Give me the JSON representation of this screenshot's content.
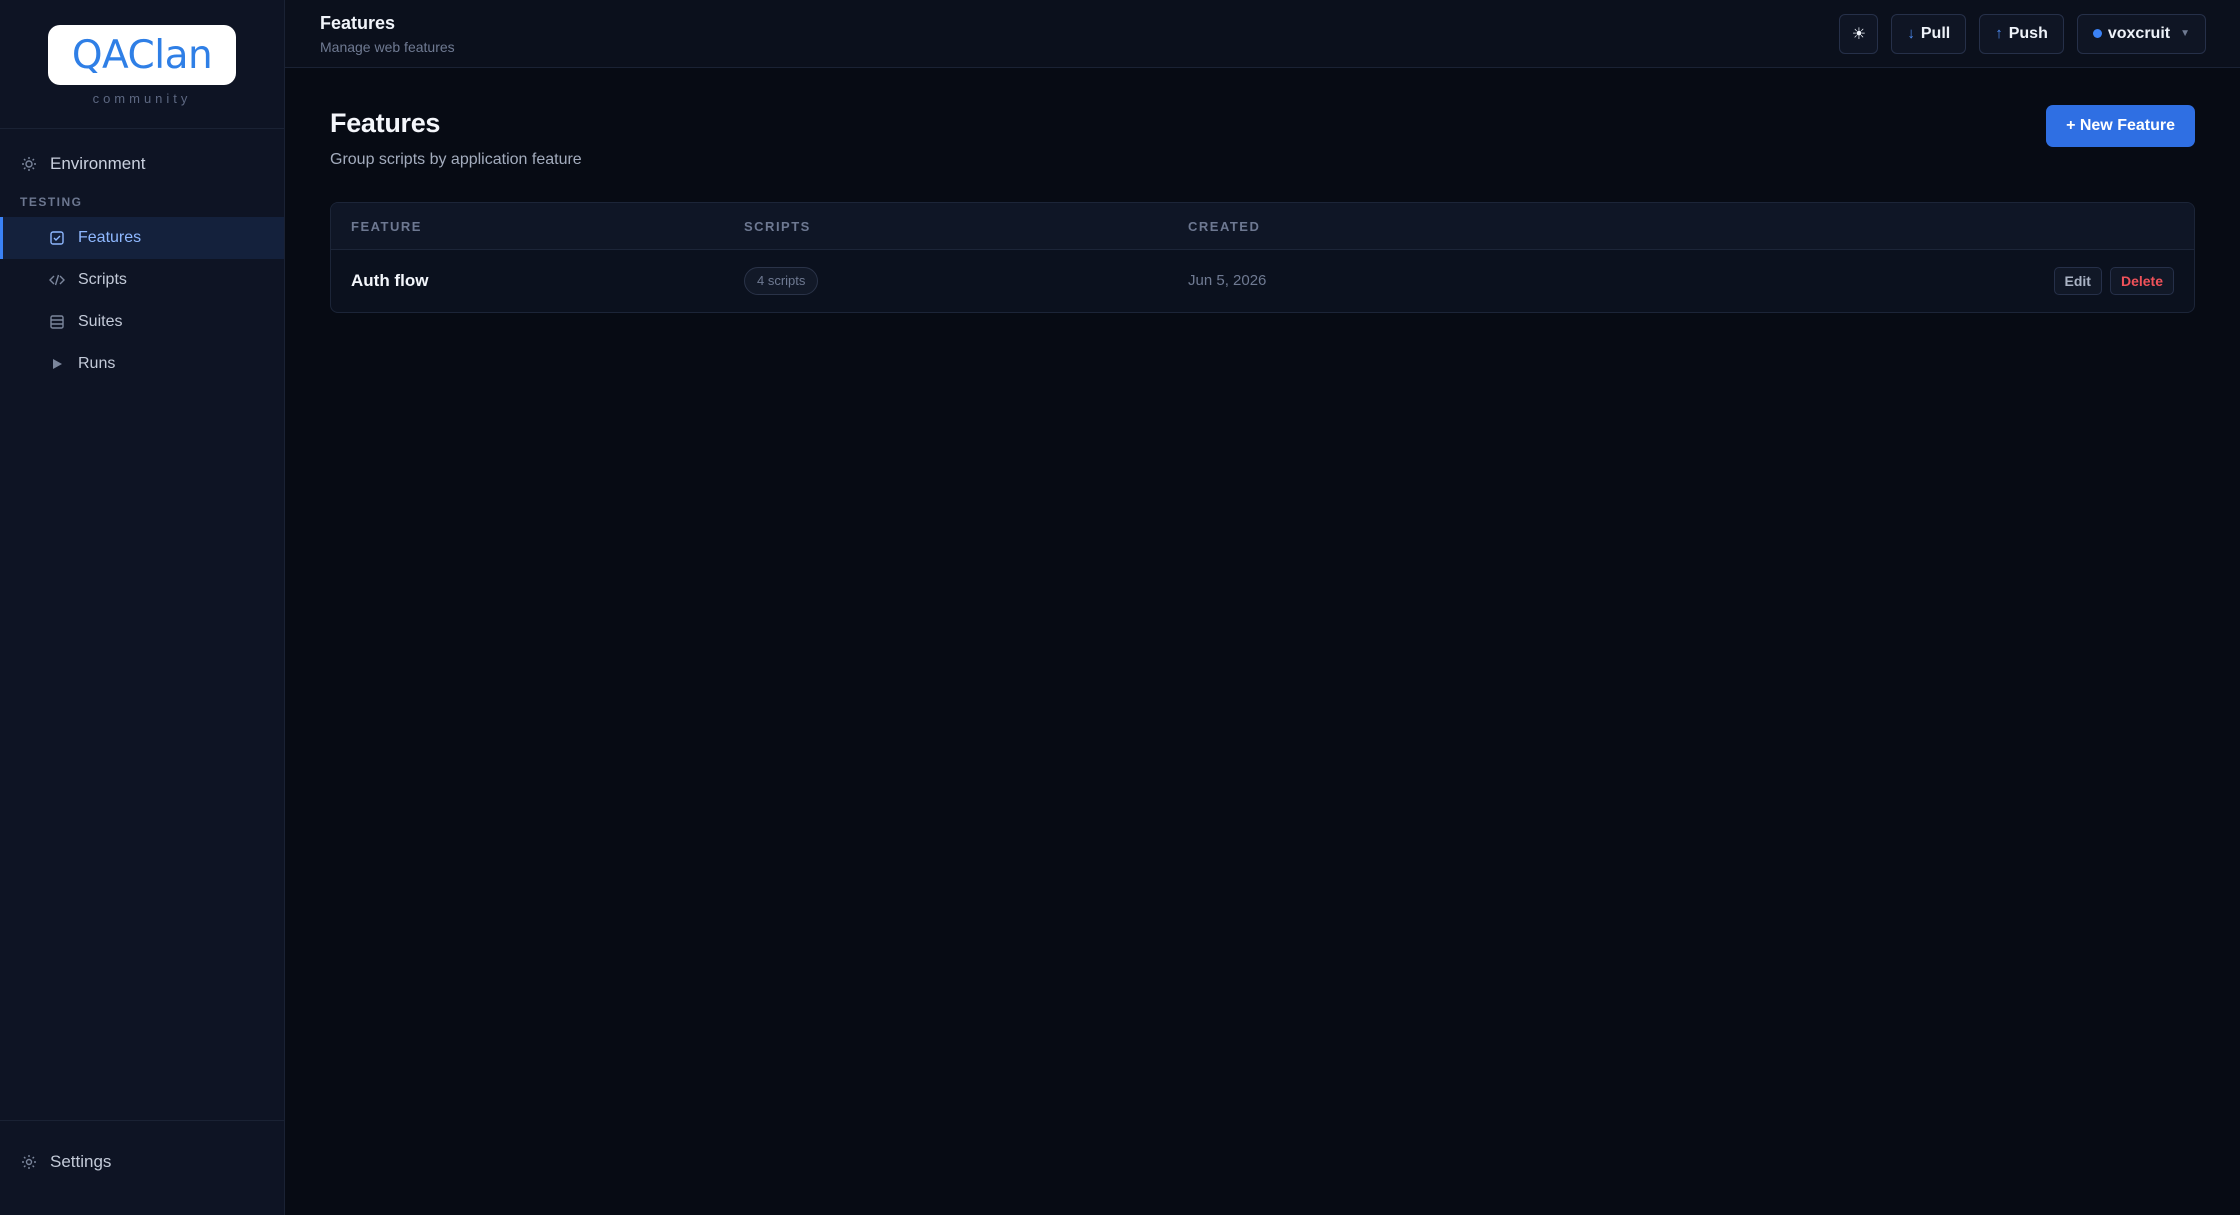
{
  "brand": {
    "logo_text": "QAClan",
    "tagline": "community"
  },
  "sidebar": {
    "environment_label": "Environment",
    "section_label": "TESTING",
    "items": [
      {
        "label": "Features",
        "icon": "checklist-icon",
        "active": true
      },
      {
        "label": "Scripts",
        "icon": "code-icon",
        "active": false
      },
      {
        "label": "Suites",
        "icon": "stack-icon",
        "active": false
      },
      {
        "label": "Runs",
        "icon": "play-icon",
        "active": false
      }
    ],
    "settings_label": "Settings"
  },
  "topbar": {
    "title": "Features",
    "subtitle": "Manage web features",
    "theme_icon": "sun-icon",
    "pull_label": "Pull",
    "push_label": "Push",
    "user_label": "voxcruit"
  },
  "page": {
    "title": "Features",
    "subtitle": "Group scripts by application feature",
    "new_button": "+ New Feature"
  },
  "table": {
    "headers": [
      "FEATURE",
      "SCRIPTS",
      "CREATED"
    ],
    "rows": [
      {
        "feature": "Auth flow",
        "scripts": "4 scripts",
        "created": "Jun 5, 2026",
        "edit": "Edit",
        "delete": "Delete"
      }
    ]
  },
  "colors": {
    "accent": "#2f6fe3",
    "danger": "#f0525a",
    "background": "#070b14",
    "sidebar": "#0e1424"
  }
}
